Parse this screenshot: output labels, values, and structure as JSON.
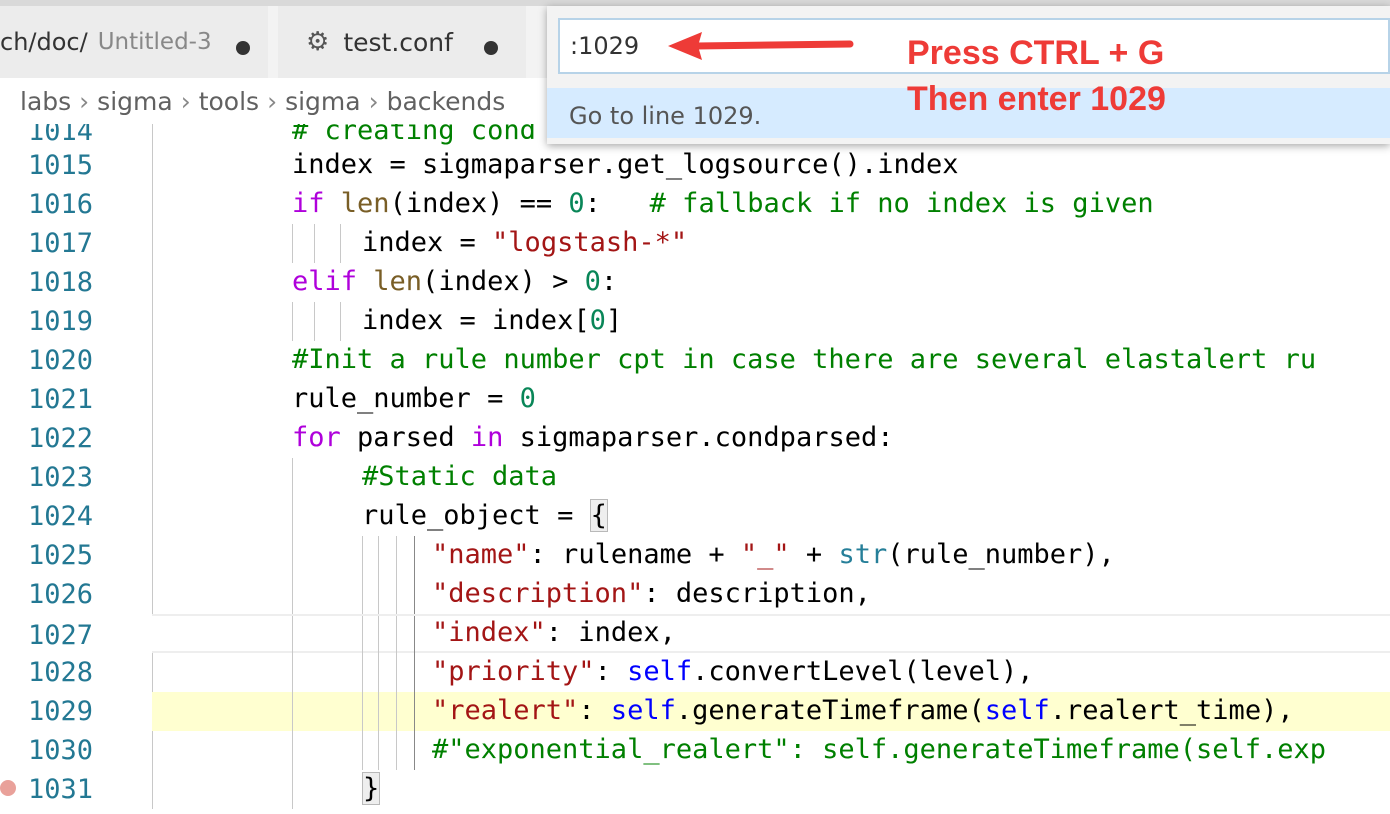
{
  "tabs": [
    {
      "path": "ch/doc/",
      "name": "Untitled-3"
    },
    {
      "name": "test.conf",
      "icon": "gear-icon"
    }
  ],
  "breadcrumb": [
    "labs",
    "sigma",
    "tools",
    "sigma",
    "backends"
  ],
  "goto_widget": {
    "input_value": ":1029",
    "hint": "Go to line 1029."
  },
  "annotation": {
    "line1": "Press CTRL + G",
    "line2": "Then enter 1029",
    "color": "#ee3b37"
  },
  "editor": {
    "current_line": 1029,
    "lines": [
      {
        "n": "1014",
        "text": "# creating cond"
      },
      {
        "n": "1015",
        "text": "index = sigmaparser.get_logsource().index"
      },
      {
        "n": "1016",
        "text": "if len(index) == 0:   # fallback if no index is given"
      },
      {
        "n": "1017",
        "text": "index = \"logstash-*\""
      },
      {
        "n": "1018",
        "text": "elif len(index) > 0:"
      },
      {
        "n": "1019",
        "text": "index = index[0]"
      },
      {
        "n": "1020",
        "text": "#Init a rule number cpt in case there are several elastalert ru"
      },
      {
        "n": "1021",
        "text": "rule_number = 0"
      },
      {
        "n": "1022",
        "text": "for parsed in sigmaparser.condparsed:"
      },
      {
        "n": "1023",
        "text": "#Static data"
      },
      {
        "n": "1024",
        "text": "rule_object = {"
      },
      {
        "n": "1025",
        "text": "\"name\": rulename + \"_\" + str(rule_number),"
      },
      {
        "n": "1026",
        "text": "\"description\": description,"
      },
      {
        "n": "1027",
        "text": "\"index\": index,"
      },
      {
        "n": "1028",
        "text": "\"priority\": self.convertLevel(level),"
      },
      {
        "n": "1029",
        "text": "\"realert\": self.generateTimeframe(self.realert_time),"
      },
      {
        "n": "1030",
        "text": "#\"exponential_realert\": self.generateTimeframe(self.exp"
      },
      {
        "n": "1031",
        "text": "}"
      }
    ]
  }
}
